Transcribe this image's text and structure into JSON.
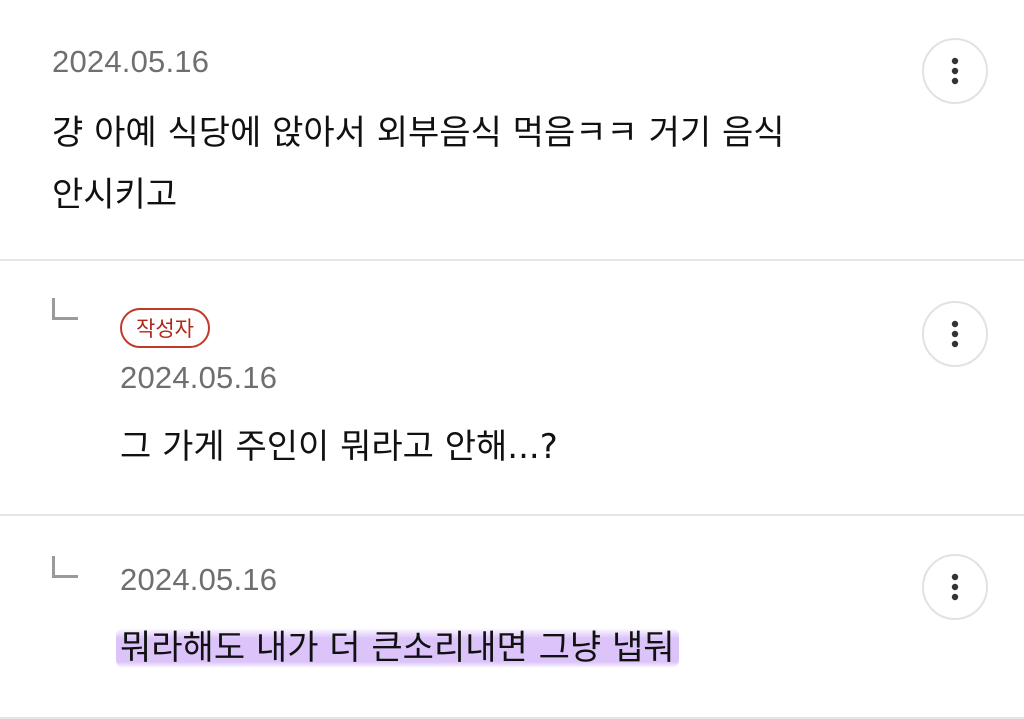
{
  "comments": [
    {
      "date": "2024.05.16",
      "text_line1": "걍 아예 식당에 앉아서 외부음식 먹음ㅋㅋ 거기 음식",
      "text_line2": "안시키고",
      "more_icon": "vertical-ellipsis-icon"
    },
    {
      "badge": "작성자",
      "date": "2024.05.16",
      "text": "그 가게 주인이 뭐라고 안해...?",
      "reply_icon": "reply-arrow-icon",
      "more_icon": "vertical-ellipsis-icon"
    },
    {
      "date": "2024.05.16",
      "text": "뭐라해도 내가 더 큰소리내면 그냥 냅둬",
      "reply_icon": "reply-arrow-icon",
      "more_icon": "vertical-ellipsis-icon",
      "highlight_color": "#d6bafa"
    }
  ]
}
